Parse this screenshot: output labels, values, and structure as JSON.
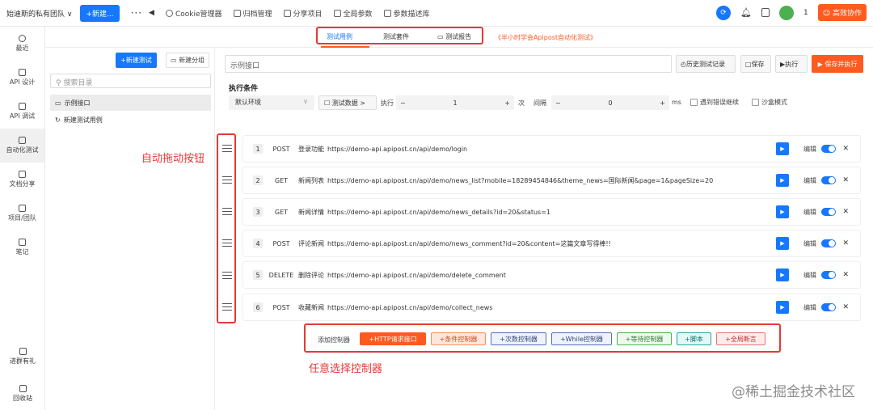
{
  "topbar": {
    "team": "始迪斯的私有团队 ∨",
    "new_btn": "+新建...",
    "more": "···",
    "back": "◀",
    "items": [
      "Cookie管理器",
      "归档管理",
      "分享项目",
      "全局参数",
      "参数描述库"
    ],
    "user_count": "1",
    "collab_btn": "高效协作"
  },
  "sidebar": {
    "items": [
      "最近",
      "API 设计",
      "API 调试",
      "自动化测试",
      "文档分享",
      "项目/团队",
      "笔记"
    ],
    "bottom": [
      "进群有礼",
      "回收站"
    ]
  },
  "tabs": [
    "测试用例",
    "测试套件",
    "测试报告"
  ],
  "promo": "《半小时学会Apipost自动化测试》",
  "left": {
    "new_test": "+新建测试",
    "new_group": "新建分组",
    "search_placeholder": "搜索目录",
    "tree": [
      "示例接口",
      "新建测试用例"
    ]
  },
  "main": {
    "name_value": "示例接口",
    "history_btn": "历史测试记录",
    "save_btn": "保存",
    "run_btn": "执行",
    "save_run_btn": "保存并执行",
    "cond_title": "执行条件",
    "env": "默认环境",
    "test_data": "测试数据",
    "exec_label": "执行",
    "exec_value": "1",
    "times_unit": "次",
    "interval_label": "间隔",
    "interval_value": "0",
    "ms_unit": "ms",
    "continue_on_error": "遇到错误继续",
    "sandbox": "沙盒模式",
    "edit_label": "编辑"
  },
  "requests": [
    {
      "num": "1",
      "method": "POST",
      "name": "登录功能",
      "url": "https://demo-api.apipost.cn/api/demo/login"
    },
    {
      "num": "2",
      "method": "GET",
      "name": "新闻列表",
      "url": "https://demo-api.apipost.cn/api/demo/news_list?mobile=18289454846&theme_news=国际新闻&page=1&pageSize=20"
    },
    {
      "num": "3",
      "method": "GET",
      "name": "新闻详情",
      "url": "https://demo-api.apipost.cn/api/demo/news_details?id=20&status=1"
    },
    {
      "num": "4",
      "method": "POST",
      "name": "评论新闻",
      "url": "https://demo-api.apipost.cn/api/demo/news_comment?id=20&content=这篇文章写得棒!!"
    },
    {
      "num": "5",
      "method": "DELETE",
      "name": "删除评论",
      "url": "https://demo-api.apipost.cn/api/demo/delete_comment"
    },
    {
      "num": "6",
      "method": "POST",
      "name": "收藏新闻",
      "url": "https://demo-api.apipost.cn/api/demo/collect_news"
    }
  ],
  "controllers": {
    "label": "添加控制器",
    "buttons": [
      "+HTTP请求接口",
      "+条件控制器",
      "+次数控制器",
      "+While控制器",
      "+等待控制器",
      "+脚本",
      "+全局断言"
    ]
  },
  "annotations": {
    "drag": "自动拖动按钮",
    "select": "任意选择控制器"
  },
  "watermark": "@稀土掘金技术社区",
  "colors": {
    "accent": "#1677ff",
    "orange": "#ff5a1f",
    "annotation_red": "#e53935"
  }
}
